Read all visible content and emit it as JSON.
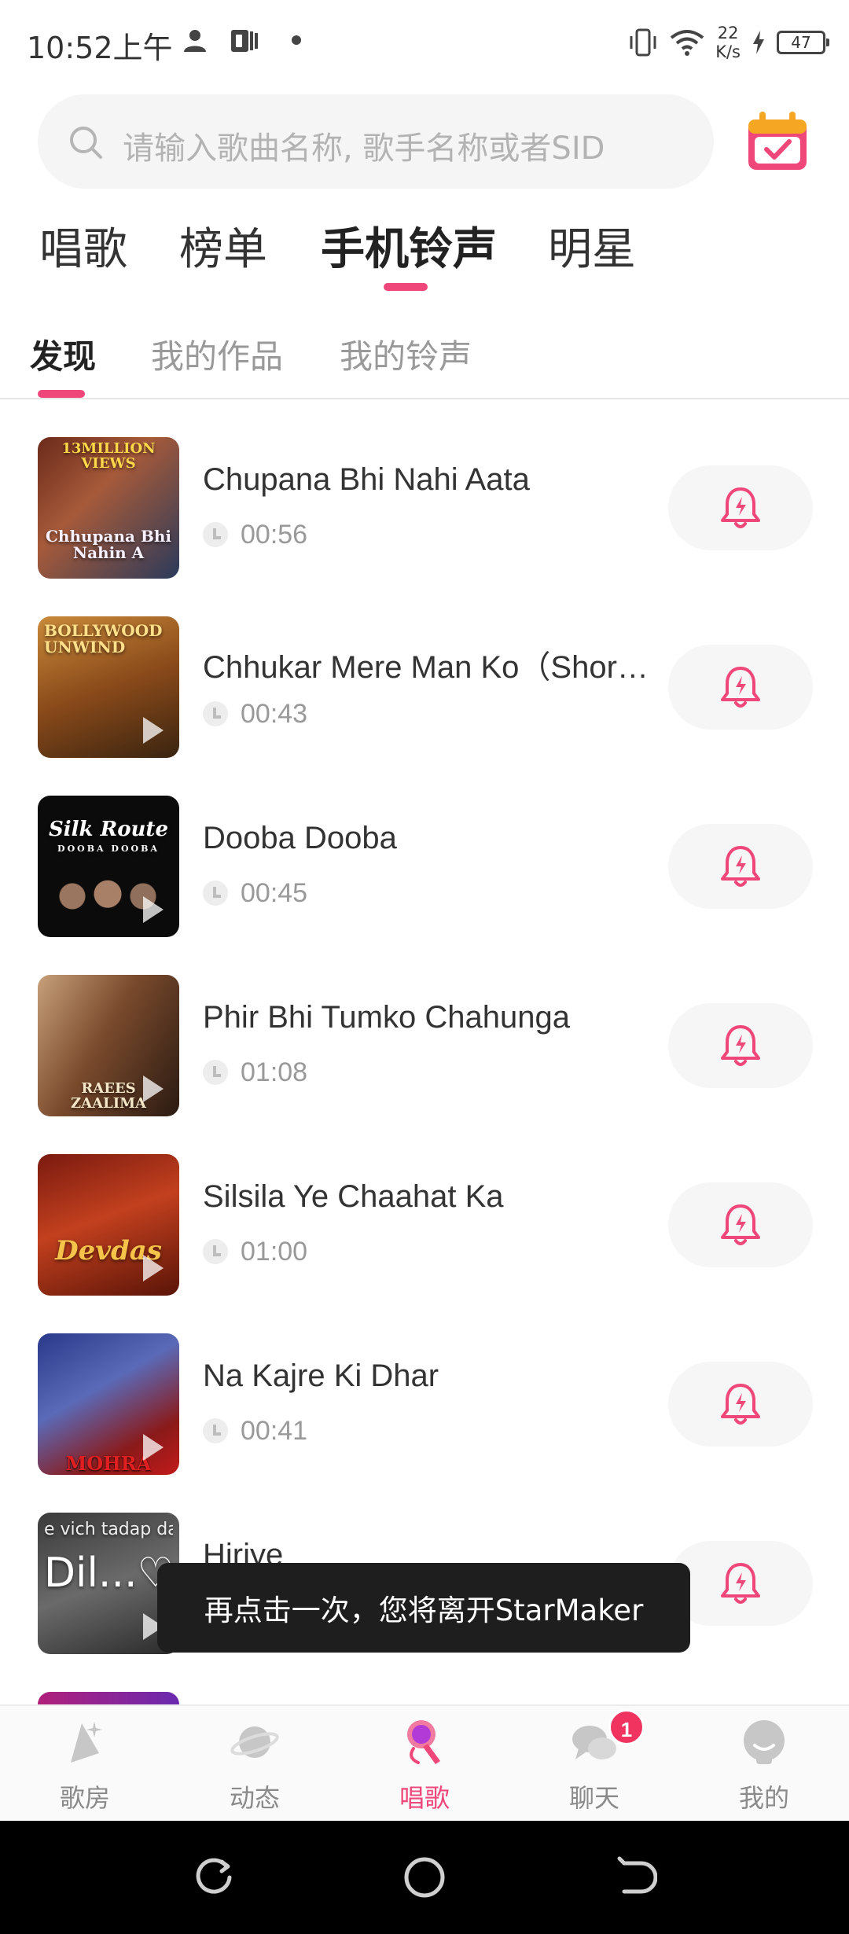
{
  "status_bar": {
    "time": "10:52上午",
    "net_speed_value": "22",
    "net_speed_unit": "K/s",
    "battery": "47"
  },
  "search": {
    "placeholder": "请输入歌曲名称, 歌手名称或者SID"
  },
  "top_tabs": [
    {
      "label": "唱歌",
      "active": false
    },
    {
      "label": "榜单",
      "active": false
    },
    {
      "label": "手机铃声",
      "active": true
    },
    {
      "label": "明星",
      "active": false
    }
  ],
  "sub_tabs": [
    {
      "label": "发现",
      "active": true
    },
    {
      "label": "我的作品",
      "active": false
    },
    {
      "label": "我的铃声",
      "active": false
    }
  ],
  "songs": [
    {
      "title": "Chupana Bhi Nahi Aata",
      "duration": "00:56",
      "cover_top": "13MILLION VIEWS",
      "cover_bottom": "Chhupana Bhi Nahin A"
    },
    {
      "title": "Chhukar Mere Man Ko（Short Ver.）",
      "duration": "00:43",
      "cover_top": "BOLLYWOOD UNWIND",
      "cover_bottom": ""
    },
    {
      "title": "Dooba Dooba",
      "duration": "00:45",
      "cover_top": "Silk Route",
      "cover_bottom": "DOOBA DOOBA"
    },
    {
      "title": "Phir Bhi Tumko Chahunga",
      "duration": "01:08",
      "cover_top": "",
      "cover_bottom": "RAEES ZAALIMA"
    },
    {
      "title": "Silsila Ye Chaahat Ka",
      "duration": "01:00",
      "cover_top": "",
      "cover_bottom": "Devdas"
    },
    {
      "title": "Na Kajre Ki Dhar",
      "duration": "00:41",
      "cover_top": "",
      "cover_bottom": "MOHRA"
    },
    {
      "title": "Hiriye",
      "duration": "",
      "cover_top": "e vich tadap da",
      "cover_bottom": "Dil...♡"
    }
  ],
  "toast": {
    "message": "再点击一次，您将离开StarMaker"
  },
  "bottom_nav": [
    {
      "label": "歌房",
      "icon": "party-room-icon",
      "active": false
    },
    {
      "label": "动态",
      "icon": "planet-icon",
      "active": false
    },
    {
      "label": "唱歌",
      "icon": "microphone-icon",
      "active": true
    },
    {
      "label": "聊天",
      "icon": "chat-bubbles-icon",
      "active": false,
      "badge": "1"
    },
    {
      "label": "我的",
      "icon": "profile-icon",
      "active": false
    }
  ],
  "colors": {
    "accent": "#f0477a",
    "text_primary": "#333333",
    "text_secondary": "#999999"
  }
}
